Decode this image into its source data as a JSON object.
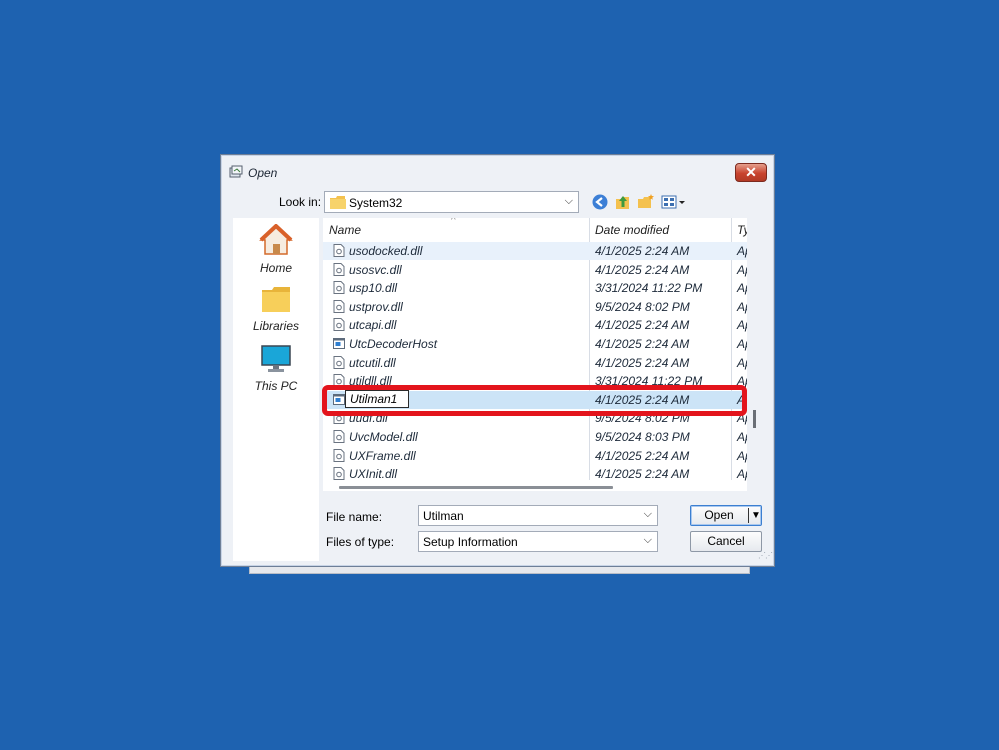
{
  "dialog": {
    "title": "Open",
    "close_glyph": "✕",
    "look_in_label": "Look in:",
    "look_in_value": "System32",
    "places": [
      {
        "label": "Home",
        "icon": "home-icon"
      },
      {
        "label": "Libraries",
        "icon": "libraries-icon"
      },
      {
        "label": "This PC",
        "icon": "this-pc-icon"
      }
    ],
    "columns": {
      "name": "Name",
      "date": "Date modified",
      "type": "Ty"
    },
    "files": [
      {
        "name": "usodocked.dll",
        "date": "4/1/2025 2:24 AM",
        "type": "Ap",
        "kind": "dll"
      },
      {
        "name": "usosvc.dll",
        "date": "4/1/2025 2:24 AM",
        "type": "Ap",
        "kind": "dll"
      },
      {
        "name": "usp10.dll",
        "date": "3/31/2024 11:22 PM",
        "type": "Ap",
        "kind": "dll"
      },
      {
        "name": "ustprov.dll",
        "date": "9/5/2024 8:02 PM",
        "type": "Ap",
        "kind": "dll"
      },
      {
        "name": "utcapi.dll",
        "date": "4/1/2025 2:24 AM",
        "type": "Ap",
        "kind": "dll"
      },
      {
        "name": "UtcDecoderHost",
        "date": "4/1/2025 2:24 AM",
        "type": "Ap",
        "kind": "exe"
      },
      {
        "name": "utcutil.dll",
        "date": "4/1/2025 2:24 AM",
        "type": "Ap",
        "kind": "dll"
      },
      {
        "name": "utildll.dll",
        "date": "3/31/2024 11:22 PM",
        "type": "Ap",
        "kind": "dll"
      },
      {
        "name": "Utilman1",
        "date": "4/1/2025 2:24 AM",
        "type": "Ap",
        "kind": "exe",
        "renaming": true
      },
      {
        "name": "uudf.dll",
        "date": "9/5/2024 8:02 PM",
        "type": "Ap",
        "kind": "dll"
      },
      {
        "name": "UvcModel.dll",
        "date": "9/5/2024 8:03 PM",
        "type": "Ap",
        "kind": "dll"
      },
      {
        "name": "UXFrame.dll",
        "date": "4/1/2025 2:24 AM",
        "type": "Ap",
        "kind": "dll"
      },
      {
        "name": "UXInit.dll",
        "date": "4/1/2025 2:24 AM",
        "type": "Ap",
        "kind": "dll"
      }
    ],
    "file_name_label": "File name:",
    "file_name_value": "Utilman",
    "files_of_type_label": "Files of type:",
    "files_of_type_value": "Setup Information",
    "open_button": "Open",
    "cancel_button": "Cancel"
  },
  "colors": {
    "desktop": "#1e62b0",
    "highlight_border": "#e3141c",
    "selected_row": "#cce4f7"
  }
}
